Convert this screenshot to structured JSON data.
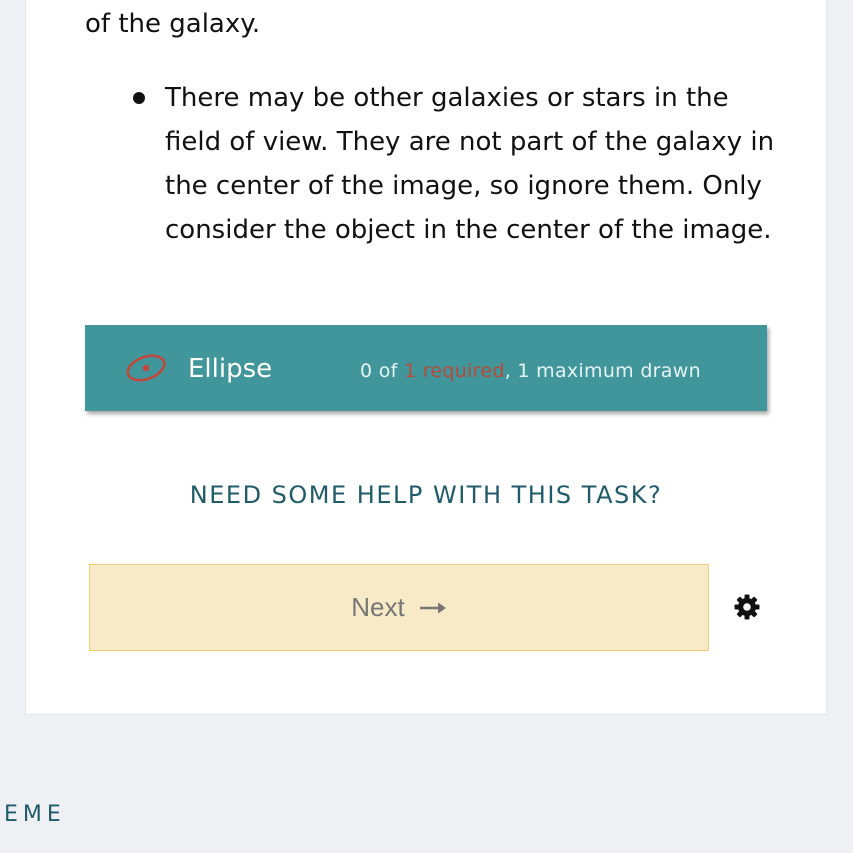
{
  "content": {
    "top_line": "of the galaxy.",
    "bullets": [
      "There may be other galaxies or stars in the field of view. They are not part of the galaxy in the center of the image, so ignore them. Only consider the object in the center of the image."
    ]
  },
  "tool": {
    "icon": "ellipse-icon",
    "label": "Ellipse",
    "status_prefix": "0 of ",
    "status_required": "1 required",
    "status_suffix": ", 1 maximum drawn",
    "icon_color": "#c4453a",
    "bar_color": "#40969a"
  },
  "help": {
    "link_label": "NEED SOME HELP WITH THIS TASK?"
  },
  "actions": {
    "next_label": "Next",
    "next_icon": "arrow-right-icon",
    "settings_icon": "gear-icon"
  },
  "footer": {
    "partial_text": "EME"
  }
}
